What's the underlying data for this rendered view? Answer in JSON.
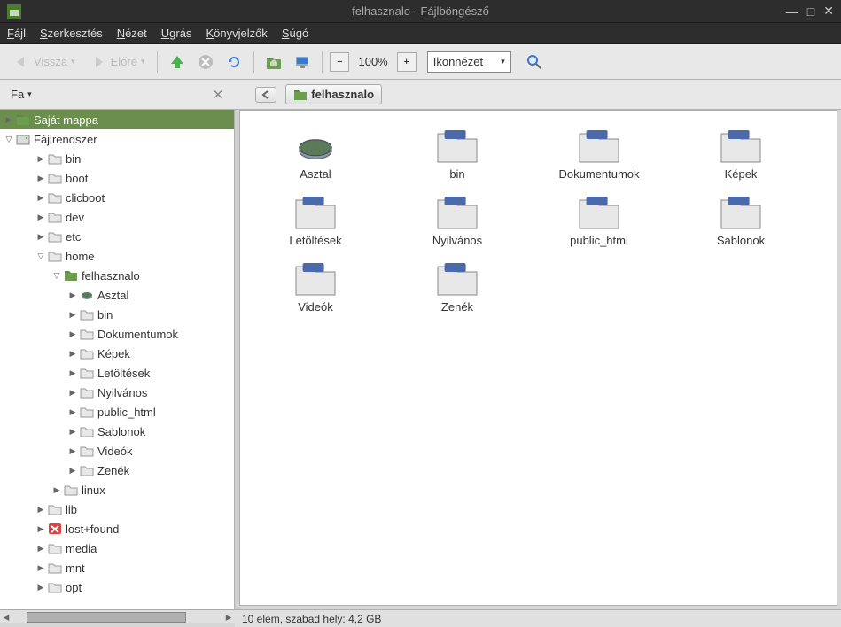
{
  "window": {
    "title": "felhasznalo - Fájlböngésző"
  },
  "menu": {
    "file": "Fájl",
    "edit": "Szerkesztés",
    "view": "Nézet",
    "go": "Ugrás",
    "bookmarks": "Könyvjelzők",
    "help": "Súgó"
  },
  "toolbar": {
    "back": "Vissza",
    "forward": "Előre",
    "zoom": "100%",
    "view_mode": "Ikonnézet"
  },
  "location": {
    "fav": "Fa",
    "current": "felhasznalo"
  },
  "tree": {
    "home": "Saját mappa",
    "filesystem": "Fájlrendszer",
    "bin": "bin",
    "boot": "boot",
    "clicboot": "clicboot",
    "dev": "dev",
    "etc": "etc",
    "home_dir": "home",
    "felhasznalo": "felhasznalo",
    "asztal": "Asztal",
    "bin2": "bin",
    "dokumentumok": "Dokumentumok",
    "kepek": "Képek",
    "letoltesek": "Letöltések",
    "nyilvanos": "Nyilvános",
    "public_html": "public_html",
    "sablonok": "Sablonok",
    "videok": "Videók",
    "zenek": "Zenék",
    "linux": "linux",
    "lib": "lib",
    "lostfound": "lost+found",
    "media": "media",
    "mnt": "mnt",
    "opt": "opt"
  },
  "files": [
    {
      "name": "Asztal",
      "type": "desktop"
    },
    {
      "name": "bin",
      "type": "folder"
    },
    {
      "name": "Dokumentumok",
      "type": "folder"
    },
    {
      "name": "Képek",
      "type": "folder"
    },
    {
      "name": "Letöltések",
      "type": "folder"
    },
    {
      "name": "Nyilvános",
      "type": "folder"
    },
    {
      "name": "public_html",
      "type": "folder"
    },
    {
      "name": "Sablonok",
      "type": "folder"
    },
    {
      "name": "Videók",
      "type": "folder"
    },
    {
      "name": "Zenék",
      "type": "folder"
    }
  ],
  "status": "10 elem, szabad hely: 4,2 GB"
}
